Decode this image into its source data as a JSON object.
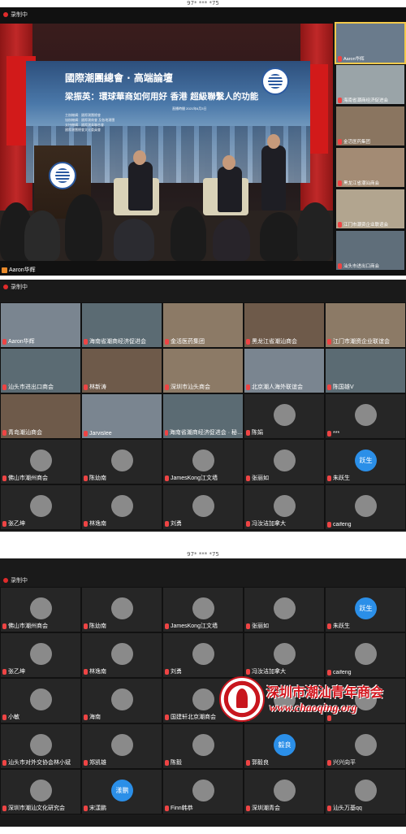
{
  "top_mark": "97* *** *75",
  "recording_label": "录制中",
  "screen1": {
    "backdrop_title": "國際潮團總會 · 高端論壇",
    "backdrop_subtitle": "梁振英：環球華商如何用好 香港 超級聯繫人的功能",
    "backdrop_lines": [
      "主辦機構：國際潮團總會",
      "協辦機構：國際潮商會 及各地潮團",
      "支持機構：國際潮青聯合會",
      "國際潮團總會文化委員會"
    ],
    "backdrop_date": "直播時間 2021年6月3日",
    "speaker_name": "Aaron华辉",
    "side_tiles": [
      {
        "label": "Aaron华辉",
        "active": true
      },
      {
        "label": "海南省潮商经济促进会",
        "active": false
      },
      {
        "label": "金活医药集团",
        "active": false
      },
      {
        "label": "黑龙江省潮汕商会",
        "active": false
      },
      {
        "label": "江门市潮资企业联谊会",
        "active": false
      },
      {
        "label": "汕头市进出口商会",
        "active": false
      }
    ]
  },
  "gallery2": [
    {
      "label": "Aaron华辉",
      "type": "vid4"
    },
    {
      "label": "海南省潮商经济促进会",
      "type": "vid"
    },
    {
      "label": "金活医药集团",
      "type": "vid2"
    },
    {
      "label": "黑龙江省潮汕商会",
      "type": "vid3"
    },
    {
      "label": "江门市潮资企业联谊会",
      "type": "vid2"
    },
    {
      "label": "汕头市进出口商会",
      "type": "vid"
    },
    {
      "label": "林新涛",
      "type": "vid3"
    },
    {
      "label": "深圳市汕头商会",
      "type": "vid2"
    },
    {
      "label": "北京潮人海外联谊会",
      "type": "vid4"
    },
    {
      "label": "陈国雄V",
      "type": "vid"
    },
    {
      "label": "青岛潮汕商会",
      "type": "vid3"
    },
    {
      "label": "Jarvislee",
      "type": "vid4"
    },
    {
      "label": "海南省潮商经济促进会 · 秘…",
      "type": "vid"
    },
    {
      "label": "陈娟",
      "type": "avatar"
    },
    {
      "label": "***",
      "type": "avatar"
    },
    {
      "label": "佛山市潮州商会",
      "type": "avatar"
    },
    {
      "label": "陈幼南",
      "type": "avatar"
    },
    {
      "label": "JamesKong江文墙",
      "type": "avatar"
    },
    {
      "label": "张丽如",
      "type": "avatar"
    },
    {
      "label": "朱跃生",
      "type": "blue",
      "initials": "跃生"
    },
    {
      "label": "张乙坤",
      "type": "avatar"
    },
    {
      "label": "林逸南",
      "type": "avatar"
    },
    {
      "label": "刘勇",
      "type": "avatar"
    },
    {
      "label": "冯汝洁加拿大",
      "type": "avatar"
    },
    {
      "label": "caifeng",
      "type": "avatar"
    }
  ],
  "gallery3": [
    {
      "label": "佛山市潮州商会",
      "type": "avatar"
    },
    {
      "label": "陈幼南",
      "type": "avatar"
    },
    {
      "label": "JamesKong江文墙",
      "type": "avatar"
    },
    {
      "label": "张丽如",
      "type": "avatar"
    },
    {
      "label": "朱跃生",
      "type": "blue",
      "initials": "跃生"
    },
    {
      "label": "张乙坤",
      "type": "avatar"
    },
    {
      "label": "林逸南",
      "type": "avatar"
    },
    {
      "label": "刘勇",
      "type": "avatar"
    },
    {
      "label": "冯汝洁加拿大",
      "type": "avatar"
    },
    {
      "label": "caifeng",
      "type": "avatar"
    },
    {
      "label": "小敏",
      "type": "avatar"
    },
    {
      "label": "海南",
      "type": "avatar"
    },
    {
      "label": "国建轩北京潮商会",
      "type": "avatar"
    },
    {
      "label": "",
      "type": "avatar"
    },
    {
      "label": "",
      "type": "avatar"
    },
    {
      "label": "汕头市对外交协会林小斌",
      "type": "avatar"
    },
    {
      "label": "郑凯雄",
      "type": "avatar"
    },
    {
      "label": "陈毅",
      "type": "avatar"
    },
    {
      "label": "郭毅良",
      "type": "blue",
      "initials": "毅良"
    },
    {
      "label": "兴兴向平",
      "type": "avatar"
    },
    {
      "label": "深圳市潮汕文化研究会",
      "type": "avatar"
    },
    {
      "label": "宋漾鹏",
      "type": "blue",
      "initials": "漾鹏"
    },
    {
      "label": "Finn韩恭",
      "type": "avatar"
    },
    {
      "label": "深圳潮青会",
      "type": "avatar"
    },
    {
      "label": "汕头万基qq",
      "type": "avatar"
    }
  ],
  "watermark": {
    "title": "深圳市潮汕青年商会",
    "url": "www.chaoqing.org"
  }
}
